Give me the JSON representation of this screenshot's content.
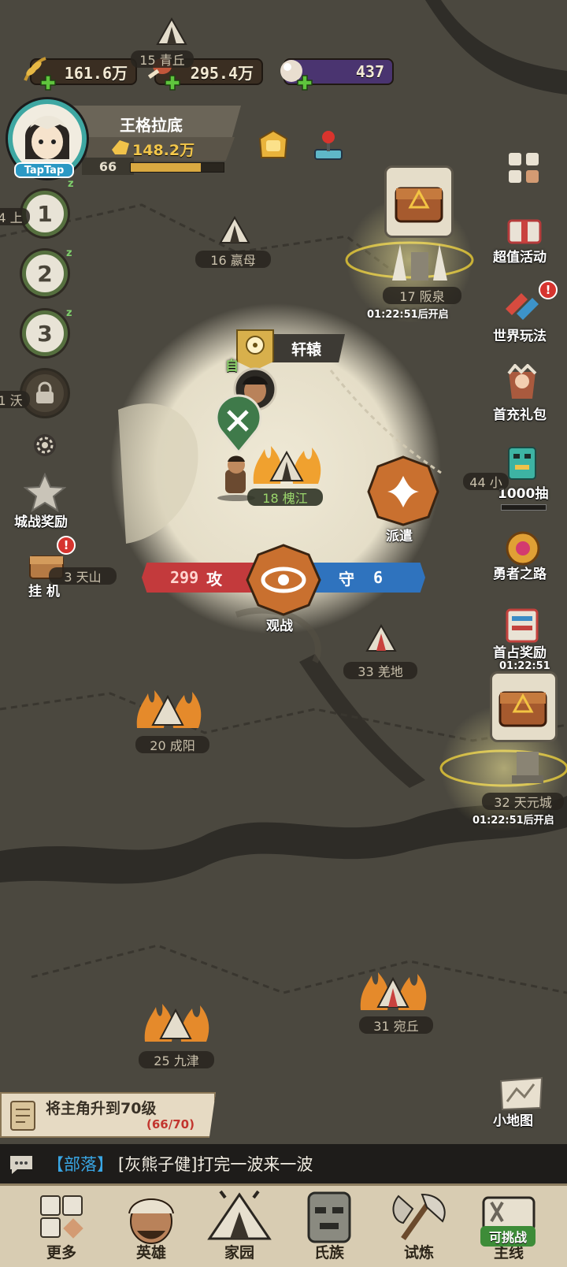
{
  "resources": {
    "grain": "161.6万",
    "meat": "295.4万",
    "gems": "437"
  },
  "player": {
    "name": "王格拉底",
    "power": "148.2万",
    "level": "66",
    "avatar_tag": "TapTap",
    "xp_fraction": 0.75
  },
  "left_stages": [
    "1",
    "2",
    "3"
  ],
  "left_menu": {
    "city_reward": "城战奖励",
    "idle": "挂 机"
  },
  "right_menu": {
    "value_event": "超值活动",
    "world_play": "世界玩法",
    "first_charge": "首充礼包",
    "draw_1000": "1000抽",
    "hero_road": "勇者之路",
    "first_occupy": "首占奖励",
    "first_occupy_timer": "01:22:51",
    "minimap": "小地图"
  },
  "map": {
    "cities": [
      {
        "label": "15 青丘",
        "green": false
      },
      {
        "label": "16 嬴母",
        "green": false
      },
      {
        "label": "17 阪泉",
        "green": false
      },
      {
        "label": "18 槐江",
        "green": true
      },
      {
        "label": "20 成阳",
        "green": false
      },
      {
        "label": "33 羌地",
        "green": false
      },
      {
        "label": "32 天元城",
        "green": false
      },
      {
        "label": "31 宛丘",
        "green": false
      },
      {
        "label": "25 九津",
        "green": false
      },
      {
        "label": "4 上",
        "green": false
      },
      {
        "label": "1 沃",
        "green": false
      },
      {
        "label": "3 天山",
        "green": false
      },
      {
        "label": "44 小",
        "green": false
      }
    ],
    "timer_banquan": "01:22:51后开启",
    "timer_tianyuan": "01:22:51后开启",
    "xuanyuan": "轩辕",
    "own_city_tag": "自",
    "dispatch": "派遣",
    "spectate": "观战",
    "attack": {
      "value": "299",
      "label": "攻"
    },
    "defense": {
      "label": "守",
      "value": "6"
    }
  },
  "quest": {
    "title": "将主角升到70级",
    "progress": "(66/70)"
  },
  "chat": {
    "channel": "【部落】",
    "message": "[灰熊子健]打完一波来一波"
  },
  "nav": {
    "more": "更多",
    "hero": "英雄",
    "home": "家园",
    "clan": "氏族",
    "trial": "试炼",
    "main": "主线",
    "challenge_badge": "可挑战"
  }
}
